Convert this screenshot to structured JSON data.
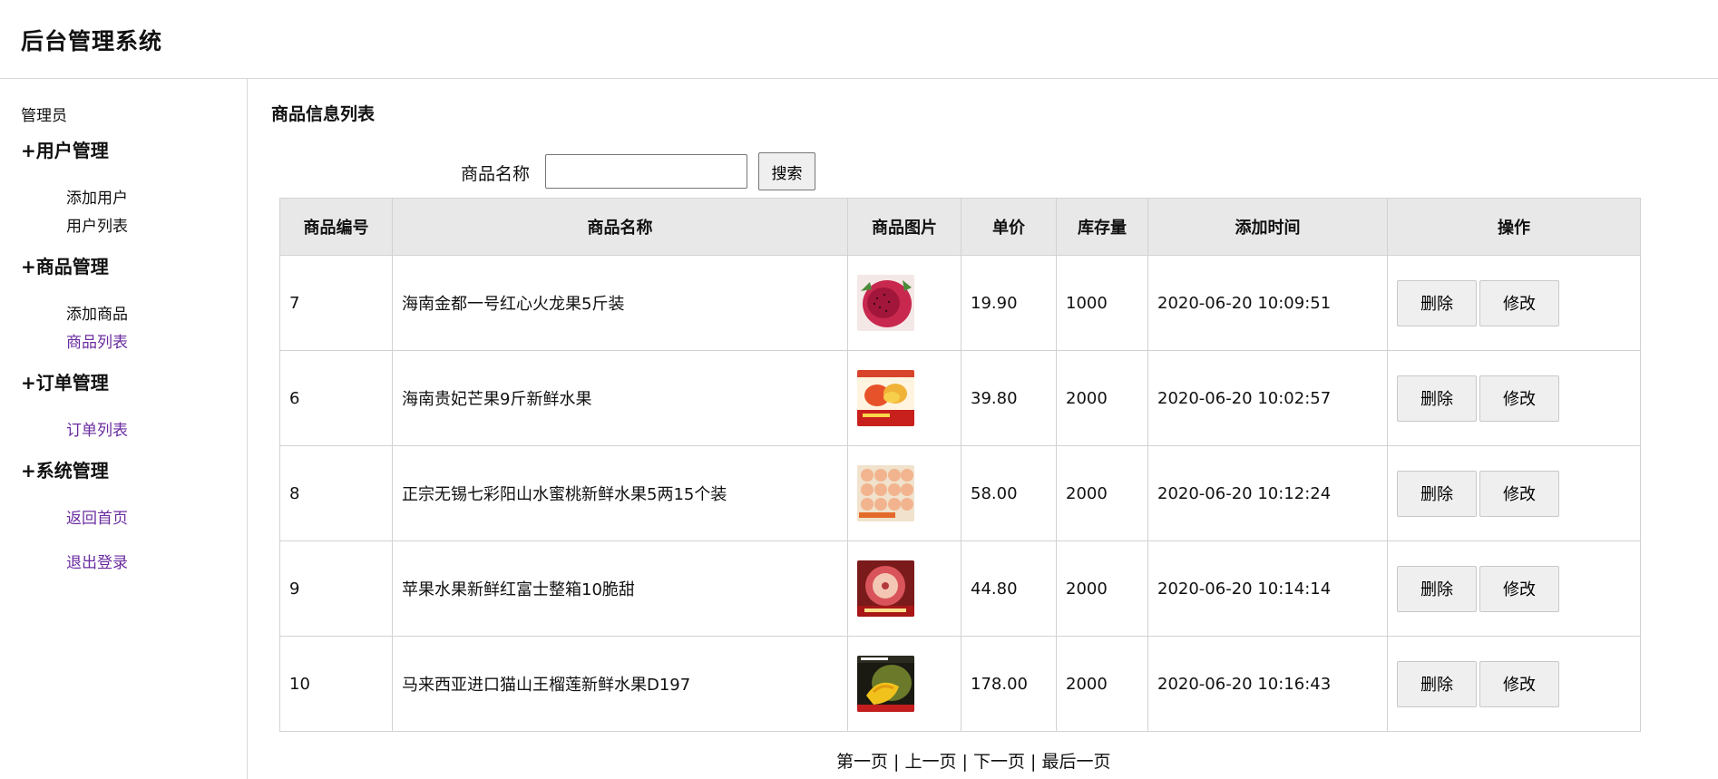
{
  "app": {
    "title": "后台管理系统"
  },
  "sidebar": {
    "role": "管理员",
    "groups": [
      {
        "title": "+用户管理",
        "items": [
          "添加用户",
          "用户列表"
        ]
      },
      {
        "title": "+商品管理",
        "items": [
          "添加商品",
          "商品列表"
        ]
      },
      {
        "title": "+订单管理",
        "items": [
          "订单列表"
        ]
      },
      {
        "title": "+系统管理",
        "items": [
          "返回首页",
          "退出登录"
        ]
      }
    ]
  },
  "main": {
    "heading": "商品信息列表",
    "search": {
      "label": "商品名称",
      "value": "",
      "button": "搜索"
    },
    "table": {
      "headers": [
        "商品编号",
        "商品名称",
        "商品图片",
        "单价",
        "库存量",
        "添加时间",
        "操作"
      ],
      "rows": [
        {
          "id": "7",
          "name": "海南金都一号红心火龙果5斤装",
          "image": "dragon-fruit-image",
          "price": "19.90",
          "stock": "1000",
          "time": "2020-06-20 10:09:51"
        },
        {
          "id": "6",
          "name": "海南贵妃芒果9斤新鲜水果",
          "image": "mango-image",
          "price": "39.80",
          "stock": "2000",
          "time": "2020-06-20 10:02:57"
        },
        {
          "id": "8",
          "name": "正宗无锡七彩阳山水蜜桃新鲜水果5两15个装",
          "image": "peach-box-image",
          "price": "58.00",
          "stock": "2000",
          "time": "2020-06-20 10:12:24"
        },
        {
          "id": "9",
          "name": "苹果水果新鲜红富士整箱10脆甜",
          "image": "apple-image",
          "price": "44.80",
          "stock": "2000",
          "time": "2020-06-20 10:14:14"
        },
        {
          "id": "10",
          "name": "马来西亚进口猫山王榴莲新鲜水果D197",
          "image": "durian-image",
          "price": "178.00",
          "stock": "2000",
          "time": "2020-06-20 10:16:43"
        }
      ],
      "actions": {
        "delete": "删除",
        "edit": "修改"
      }
    },
    "pager": {
      "first": "第一页",
      "prev": "上一页",
      "next": "下一页",
      "last": "最后一页",
      "sep": " | "
    }
  }
}
